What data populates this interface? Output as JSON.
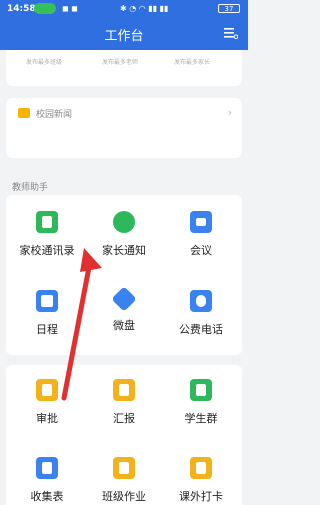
{
  "status": {
    "time": "14:58",
    "battery": "37"
  },
  "header": {
    "title": "工作台"
  },
  "top_labels": [
    "发布最多班级",
    "发布最多老师",
    "发布最多家长"
  ],
  "news": {
    "label": "校园新闻"
  },
  "section": {
    "title": "教师助手"
  },
  "grid1": [
    {
      "label": "家校通讯录",
      "icon": "contacts-icon",
      "color": "#2db85c"
    },
    {
      "label": "家长通知",
      "icon": "chat-bubble-icon",
      "color": "#2db85c"
    },
    {
      "label": "会议",
      "icon": "meeting-icon",
      "color": "#3a82f0"
    },
    {
      "label": "日程",
      "icon": "calendar-icon",
      "color": "#3a82f0"
    },
    {
      "label": "微盘",
      "icon": "cloud-drive-icon",
      "color": "#3a82f0"
    },
    {
      "label": "公费电话",
      "icon": "phone-icon",
      "color": "#3a82f0"
    }
  ],
  "grid2": [
    {
      "label": "审批",
      "icon": "approval-stamp-icon",
      "color": "#f2b21c"
    },
    {
      "label": "汇报",
      "icon": "report-icon",
      "color": "#f2b21c"
    },
    {
      "label": "学生群",
      "icon": "student-group-icon",
      "color": "#2db85c"
    },
    {
      "label": "收集表",
      "icon": "form-icon",
      "color": "#3a82f0"
    },
    {
      "label": "班级作业",
      "icon": "homework-icon",
      "color": "#f2b21c"
    },
    {
      "label": "课外打卡",
      "icon": "checkin-icon",
      "color": "#f2b21c"
    }
  ]
}
